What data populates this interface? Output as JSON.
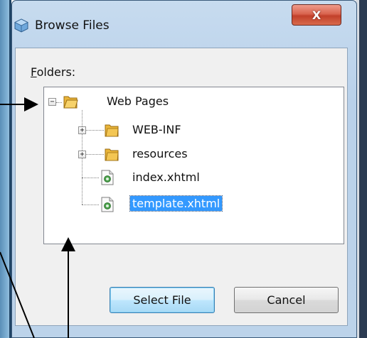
{
  "dialog": {
    "title": "Browse Files",
    "close_label": "X"
  },
  "folders": {
    "label_mnemonic": "F",
    "label_rest": "olders:"
  },
  "tree": {
    "root": {
      "label": "Web Pages",
      "expanded": true
    },
    "children": [
      {
        "label": "WEB-INF",
        "type": "folder",
        "expanded": false
      },
      {
        "label": "resources",
        "type": "folder",
        "expanded": false
      },
      {
        "label": "index.xhtml",
        "type": "file"
      },
      {
        "label": "template.xhtml",
        "type": "file",
        "selected": true
      }
    ]
  },
  "buttons": {
    "select_label": "Select File",
    "cancel_label": "Cancel"
  },
  "colors": {
    "selection": "#3399ff",
    "folder": "#e8b43c",
    "close_button": "#c94a33"
  }
}
